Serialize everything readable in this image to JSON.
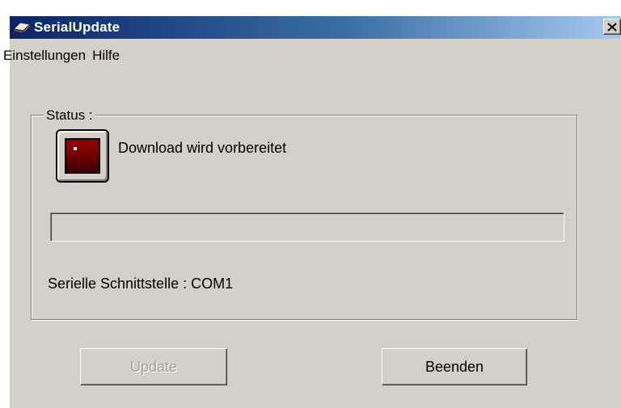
{
  "window": {
    "title": "SerialUpdate",
    "title_gradient": [
      "#0a246a",
      "#3a6ea5",
      "#a6caf0"
    ],
    "background": "#d4d0c8"
  },
  "menu": {
    "items": [
      {
        "label": "Einstellungen"
      },
      {
        "label": "Hilfe"
      }
    ]
  },
  "status_group": {
    "label": "Status :",
    "indicator_icon": "status-lamp-icon",
    "indicator_color": "#8b0000",
    "status_text": "Download wird vorbereitet",
    "progress_fraction": 0,
    "port_text": "Serielle Schnittstelle : COM1"
  },
  "buttons": {
    "update_label": "Update",
    "update_enabled": false,
    "exit_label": "Beenden"
  }
}
